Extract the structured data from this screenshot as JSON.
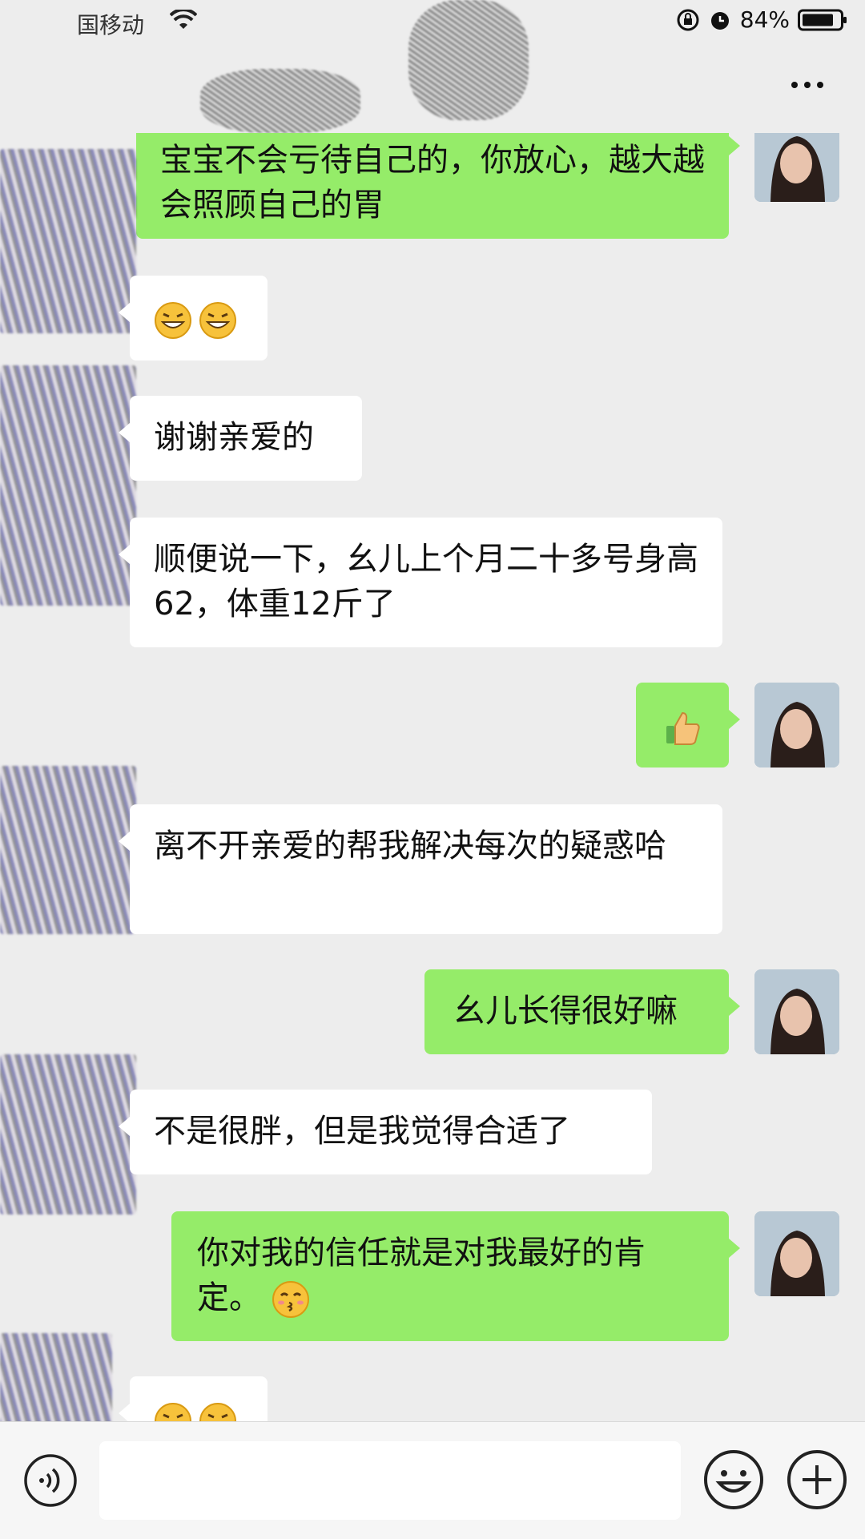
{
  "status_bar": {
    "carrier": "国移动",
    "battery": "84%"
  },
  "nav": {
    "more_label": "..."
  },
  "messages": [
    {
      "side": "right",
      "text": "宝宝不会亏待自己的，你放心，越大越会照顾自己的胃"
    },
    {
      "side": "left",
      "text": "",
      "emojis": [
        "grin-emoji",
        "grin-emoji"
      ]
    },
    {
      "side": "left",
      "text": "谢谢亲爱的"
    },
    {
      "side": "left",
      "text": "顺便说一下，幺儿上个月二十多号身高62，体重12斤了"
    },
    {
      "side": "right",
      "text": "",
      "emojis": [
        "thumbs-up-emoji"
      ]
    },
    {
      "side": "left",
      "text": "离不开亲爱的帮我解决每次的疑惑哈"
    },
    {
      "side": "right",
      "text": "幺儿长得很好嘛"
    },
    {
      "side": "left",
      "text": "不是很胖，但是我觉得合适了"
    },
    {
      "side": "right",
      "text": "你对我的信任就是对我最好的肯定。",
      "emojis": [
        "kiss-emoji"
      ]
    },
    {
      "side": "left",
      "text": "",
      "emojis": [
        "grin-emoji",
        "grin-emoji"
      ]
    }
  ],
  "input": {
    "value": "",
    "placeholder": ""
  },
  "colors": {
    "background": "#ededed",
    "sent_bubble": "#95ec69",
    "received_bubble": "#ffffff"
  }
}
